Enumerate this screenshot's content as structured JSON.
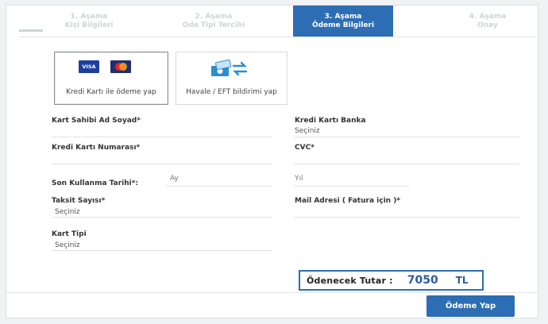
{
  "steps": [
    {
      "num": "1. Aşama",
      "name": "Kişi Bilgileri"
    },
    {
      "num": "2. Aşama",
      "name": "Oda Tipi Tercihi"
    },
    {
      "num": "3. Aşama",
      "name": "Ödeme Bilgileri"
    },
    {
      "num": "4. Aşama",
      "name": "Onay"
    }
  ],
  "payment_options": {
    "card": {
      "label": "Kredi Kartı ile ödeme yap",
      "visa_text": "VISA"
    },
    "transfer": {
      "label": "Havale / EFT bildirimi yap"
    }
  },
  "form": {
    "card_holder": {
      "label": "Kart Sahibi Ad Soyad*"
    },
    "card_bank": {
      "label": "Kredi Kartı Banka",
      "value": "Seçiniz"
    },
    "card_number": {
      "label": "Kredi Kartı Numarası*"
    },
    "cvc": {
      "label": "CVC*"
    },
    "expiry": {
      "label": "Son Kullanma Tarihi*:",
      "month_placeholder": "Ay",
      "year_placeholder": "Yıl"
    },
    "installments": {
      "label": "Taksit Sayısı*",
      "value": "Seçiniz"
    },
    "email": {
      "label": "Mail Adresi ( Fatura için )*"
    },
    "card_type": {
      "label": "Kart Tipi",
      "value": "Seçiniz"
    }
  },
  "total": {
    "label": "Ödenecek Tutar :",
    "amount": "7050",
    "currency": "TL"
  },
  "submit": {
    "label": "Ödeme Yap"
  },
  "colors": {
    "accent": "#2d6db3",
    "inactive_step": "#cfd4da"
  }
}
